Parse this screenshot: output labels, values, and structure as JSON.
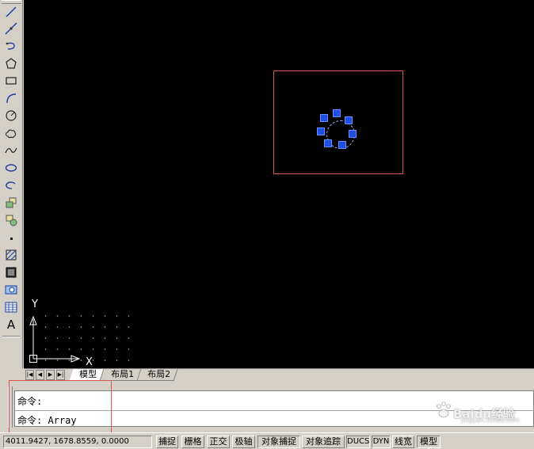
{
  "toolbar": {
    "tools": [
      {
        "name": "line-icon"
      },
      {
        "name": "construction-line-icon"
      },
      {
        "name": "polyline-icon"
      },
      {
        "name": "polygon-icon"
      },
      {
        "name": "rectangle-icon"
      },
      {
        "name": "arc-icon"
      },
      {
        "name": "circle-icon"
      },
      {
        "name": "revision-cloud-icon"
      },
      {
        "name": "spline-icon"
      },
      {
        "name": "ellipse-icon"
      },
      {
        "name": "ellipse-arc-icon"
      },
      {
        "name": "insert-block-icon"
      },
      {
        "name": "make-block-icon"
      },
      {
        "name": "point-icon"
      },
      {
        "name": "hatch-icon"
      },
      {
        "name": "gradient-icon"
      },
      {
        "name": "region-icon"
      },
      {
        "name": "table-icon"
      },
      {
        "name": "multiline-text-icon"
      }
    ],
    "text_tool_label": "A"
  },
  "canvas": {
    "background": "#000000",
    "selection_color": "#e0524a",
    "grip_color": "#1f4fe0",
    "ucs": {
      "x_label": "X",
      "y_label": "Y"
    }
  },
  "tabs": {
    "items": [
      {
        "label": "模型",
        "active": true
      },
      {
        "label": "布局1",
        "active": false
      },
      {
        "label": "布局2",
        "active": false
      }
    ]
  },
  "command": {
    "history_line": "命令:",
    "current_line": "命令: Array"
  },
  "status": {
    "coordinates": "4011.9427, 1678.8559, 0.0000",
    "buttons": [
      {
        "label": "捕捉"
      },
      {
        "label": "栅格"
      },
      {
        "label": "正交"
      },
      {
        "label": "极轴"
      },
      {
        "label": "对象捕捉"
      },
      {
        "label": "对象追踪"
      },
      {
        "label": "DUCS"
      },
      {
        "label": "DYN"
      },
      {
        "label": "线宽"
      },
      {
        "label": "模型"
      }
    ]
  },
  "watermark": {
    "text": "Baidu经验",
    "subtext": "jingyan.baidu.com"
  }
}
